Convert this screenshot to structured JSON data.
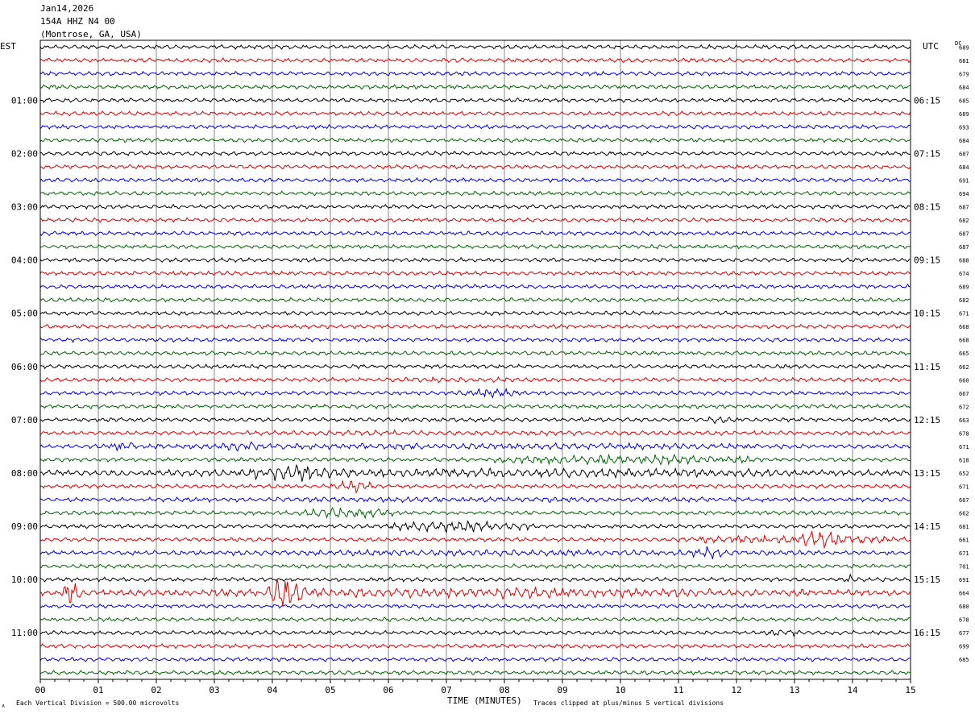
{
  "header": {
    "date": "Jan14,2026",
    "station": "154A HHZ N4 00",
    "location": "(Montrose, GA, USA)"
  },
  "labels": {
    "left_tz": "EST",
    "right_tz": "UTC",
    "dc": "DC",
    "xlabel": "TIME (MINUTES)",
    "footer_left": "Each Vertical Division =  500.00 microvolts",
    "footer_right": "Traces clipped at plus/minus 5 vertical divisions"
  },
  "colors": {
    "trace_cycle": [
      "#000000",
      "#dd0000",
      "#0000dd",
      "#006400"
    ],
    "grid": "#555555"
  },
  "chart_data": {
    "type": "helicorder",
    "x": {
      "label": "TIME (MINUTES)",
      "range": [
        0,
        15
      ],
      "ticks": [
        "00",
        "01",
        "02",
        "03",
        "04",
        "05",
        "06",
        "07",
        "08",
        "09",
        "10",
        "11",
        "12",
        "13",
        "14",
        "15"
      ]
    },
    "rows": 48,
    "left_hour_labels": [
      {
        "row": 4,
        "text": "01:00"
      },
      {
        "row": 8,
        "text": "02:00"
      },
      {
        "row": 12,
        "text": "03:00"
      },
      {
        "row": 16,
        "text": "04:00"
      },
      {
        "row": 20,
        "text": "05:00"
      },
      {
        "row": 24,
        "text": "06:00"
      },
      {
        "row": 28,
        "text": "07:00"
      },
      {
        "row": 32,
        "text": "08:00"
      },
      {
        "row": 36,
        "text": "09:00"
      },
      {
        "row": 40,
        "text": "10:00"
      },
      {
        "row": 44,
        "text": "11:00"
      }
    ],
    "right_hour_labels": [
      {
        "row": 4,
        "text": "06:15"
      },
      {
        "row": 8,
        "text": "07:15"
      },
      {
        "row": 12,
        "text": "08:15"
      },
      {
        "row": 16,
        "text": "09:15"
      },
      {
        "row": 20,
        "text": "10:15"
      },
      {
        "row": 24,
        "text": "11:15"
      },
      {
        "row": 28,
        "text": "12:15"
      },
      {
        "row": 32,
        "text": "13:15"
      },
      {
        "row": 36,
        "text": "14:15"
      },
      {
        "row": 40,
        "text": "15:15"
      },
      {
        "row": 44,
        "text": "16:15"
      }
    ],
    "dc_values": [
      "689",
      "681",
      "679",
      "684",
      "685",
      "689",
      "693",
      "684",
      "687",
      "684",
      "691",
      "694",
      "687",
      "682",
      "687",
      "687",
      "688",
      "674",
      "689",
      "682",
      "671",
      "668",
      "668",
      "665",
      "662",
      "660",
      "667",
      "672",
      "663",
      "678",
      "671",
      "618",
      "652",
      "671",
      "667",
      "662",
      "681",
      "661",
      "671",
      "701",
      "691",
      "664",
      "680",
      "678",
      "677",
      "699",
      "685"
    ],
    "activity": [
      {
        "row": 25,
        "start": 5.5,
        "end": 9.0,
        "level": 1.4
      },
      {
        "row": 26,
        "start": 7.1,
        "end": 8.3,
        "level": 2.4
      },
      {
        "row": 28,
        "start": 11.4,
        "end": 12.2,
        "level": 2.0
      },
      {
        "row": 29,
        "start": 0.0,
        "end": 15.0,
        "level": 1.3
      },
      {
        "row": 30,
        "start": 0.0,
        "end": 15.0,
        "level": 1.6
      },
      {
        "row": 30,
        "start": 1.2,
        "end": 1.7,
        "level": 3.0
      },
      {
        "row": 30,
        "start": 3.1,
        "end": 3.8,
        "level": 3.0
      },
      {
        "row": 31,
        "start": 7.8,
        "end": 12.5,
        "level": 2.6
      },
      {
        "row": 32,
        "start": 0.0,
        "end": 15.0,
        "level": 2.4
      },
      {
        "row": 32,
        "start": 3.5,
        "end": 5.3,
        "level": 4.0
      },
      {
        "row": 33,
        "start": 5.0,
        "end": 5.8,
        "level": 3.0
      },
      {
        "row": 34,
        "start": 0.0,
        "end": 15.0,
        "level": 1.4
      },
      {
        "row": 35,
        "start": 4.4,
        "end": 6.2,
        "level": 2.8
      },
      {
        "row": 36,
        "start": 6.0,
        "end": 8.5,
        "level": 3.0
      },
      {
        "row": 37,
        "start": 11.0,
        "end": 15.0,
        "level": 2.6
      },
      {
        "row": 37,
        "start": 13.0,
        "end": 14.0,
        "level": 4.5
      },
      {
        "row": 38,
        "start": 0.0,
        "end": 15.0,
        "level": 1.6
      },
      {
        "row": 38,
        "start": 11.2,
        "end": 11.8,
        "level": 3.0
      },
      {
        "row": 40,
        "start": 13.8,
        "end": 14.1,
        "level": 2.5
      },
      {
        "row": 41,
        "start": 0.0,
        "end": 15.0,
        "level": 2.4
      },
      {
        "row": 41,
        "start": 3.9,
        "end": 4.6,
        "level": 8.0
      },
      {
        "row": 41,
        "start": 0.4,
        "end": 0.7,
        "level": 6.0
      },
      {
        "row": 41,
        "start": 5.8,
        "end": 10.0,
        "level": 2.8
      },
      {
        "row": 44,
        "start": 12.5,
        "end": 13.2,
        "level": 1.8
      }
    ]
  }
}
